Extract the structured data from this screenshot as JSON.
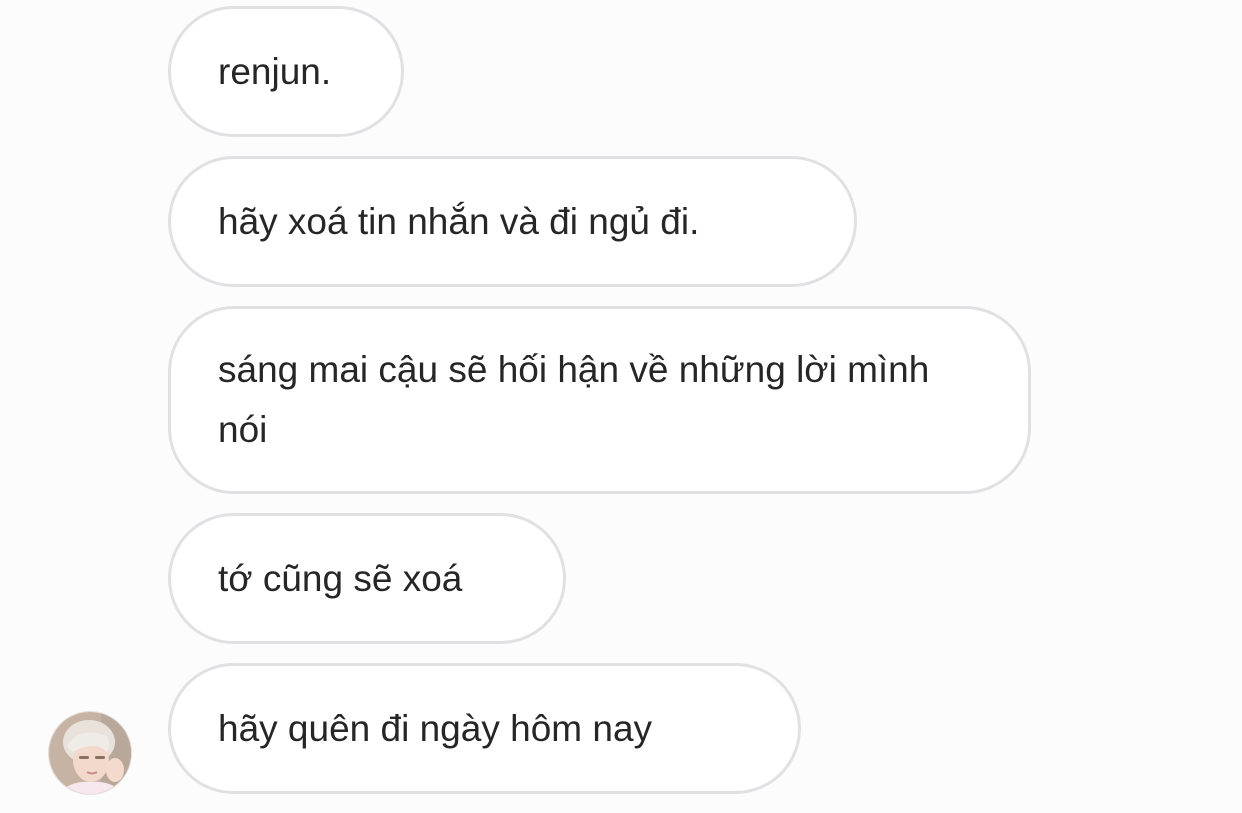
{
  "messages": [
    {
      "text": "renjun."
    },
    {
      "text": "hãy xoá tin nhắn và đi ngủ đi."
    },
    {
      "text": "sáng mai cậu sẽ hối hận về những lời mình nói"
    },
    {
      "text": "tớ cũng sẽ xoá"
    },
    {
      "text": "hãy quên đi ngày hôm nay"
    }
  ],
  "colors": {
    "background": "#fcfcfd",
    "bubble_border": "#e1e1e4",
    "bubble_fill": "#ffffff",
    "text": "#262626"
  }
}
